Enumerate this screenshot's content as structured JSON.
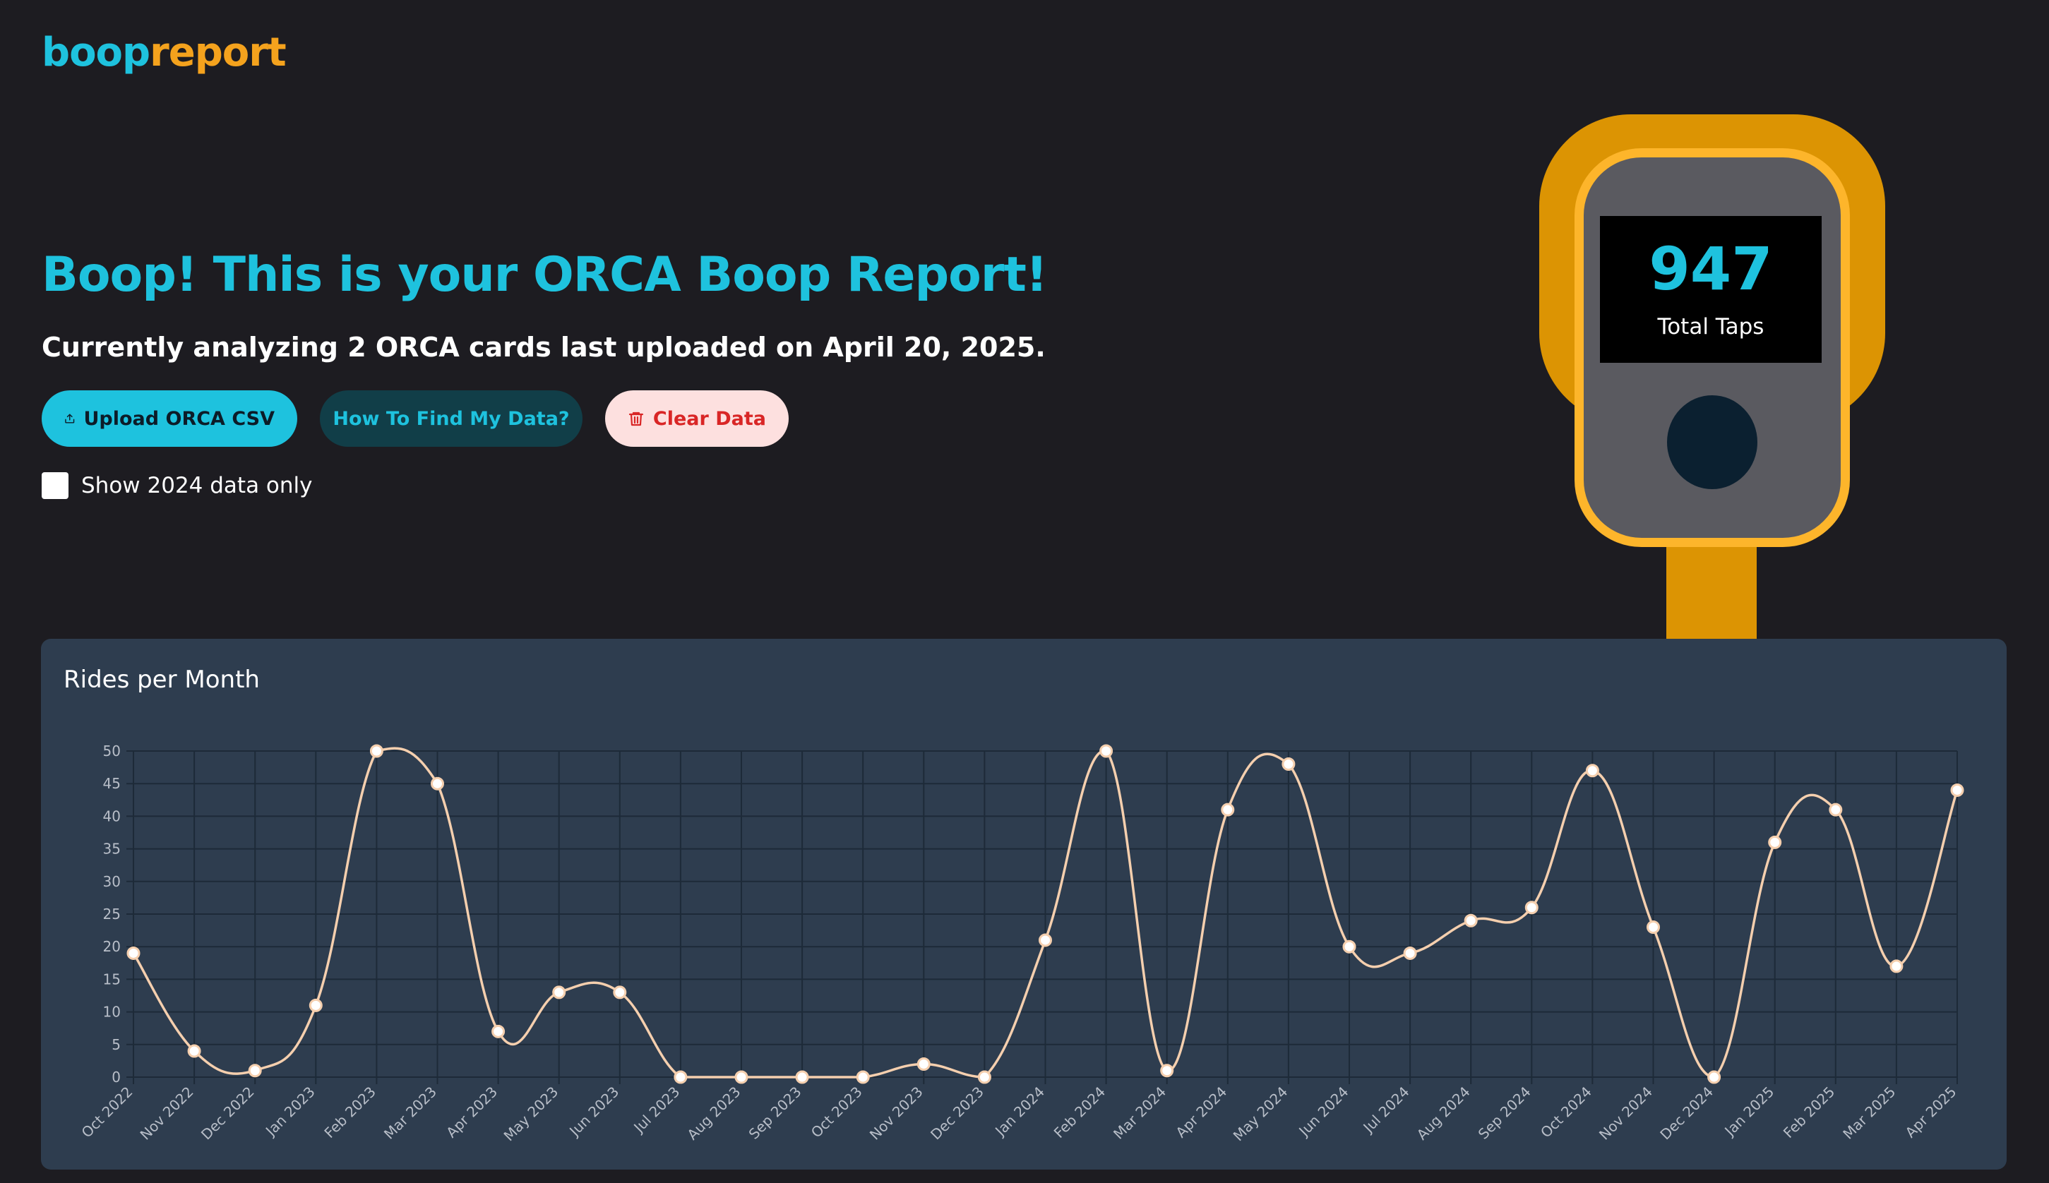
{
  "app": {
    "logo_part1": "boop",
    "logo_part2": "report"
  },
  "hero": {
    "headline": "Boop! This is your ORCA Boop Report!",
    "subline": "Currently analyzing 2 ORCA cards last uploaded on April 20, 2025."
  },
  "buttons": {
    "upload_label": "Upload ORCA CSV",
    "howto_label": "How To Find My Data?",
    "clear_label": "Clear Data"
  },
  "filter": {
    "label": "Show 2024 data only",
    "checked": false
  },
  "reader": {
    "total": "947",
    "label": "Total Taps"
  },
  "colors": {
    "accent": "#1ec2de",
    "brand_orange": "#f4a21d",
    "reader_yellow": "#fdb52b",
    "line": "#f5cfae",
    "clear_red": "#d92626"
  },
  "chart": {
    "title": "Rides per Month"
  },
  "chart_data": {
    "type": "line",
    "title": "Rides per Month",
    "xlabel": "",
    "ylabel": "",
    "ylim": [
      0,
      50
    ],
    "yticks": [
      0,
      5,
      10,
      15,
      20,
      25,
      30,
      35,
      40,
      45,
      50
    ],
    "grid": true,
    "categories": [
      "Oct 2022",
      "Nov 2022",
      "Dec 2022",
      "Jan 2023",
      "Feb 2023",
      "Mar 2023",
      "Apr 2023",
      "May 2023",
      "Jun 2023",
      "Jul 2023",
      "Aug 2023",
      "Sep 2023",
      "Oct 2023",
      "Nov 2023",
      "Dec 2023",
      "Jan 2024",
      "Feb 2024",
      "Mar 2024",
      "Apr 2024",
      "May 2024",
      "Jun 2024",
      "Jul 2024",
      "Aug 2024",
      "Sep 2024",
      "Oct 2024",
      "Nov 2024",
      "Dec 2024",
      "Jan 2025",
      "Feb 2025",
      "Mar 2025",
      "Apr 2025"
    ],
    "series": [
      {
        "values": [
          19,
          4,
          1,
          11,
          50,
          45,
          7,
          13,
          13,
          0,
          0,
          0,
          0,
          2,
          0,
          21,
          50,
          1,
          41,
          48,
          20,
          19,
          24,
          26,
          47,
          23,
          0,
          36,
          41,
          17,
          44
        ]
      }
    ]
  }
}
